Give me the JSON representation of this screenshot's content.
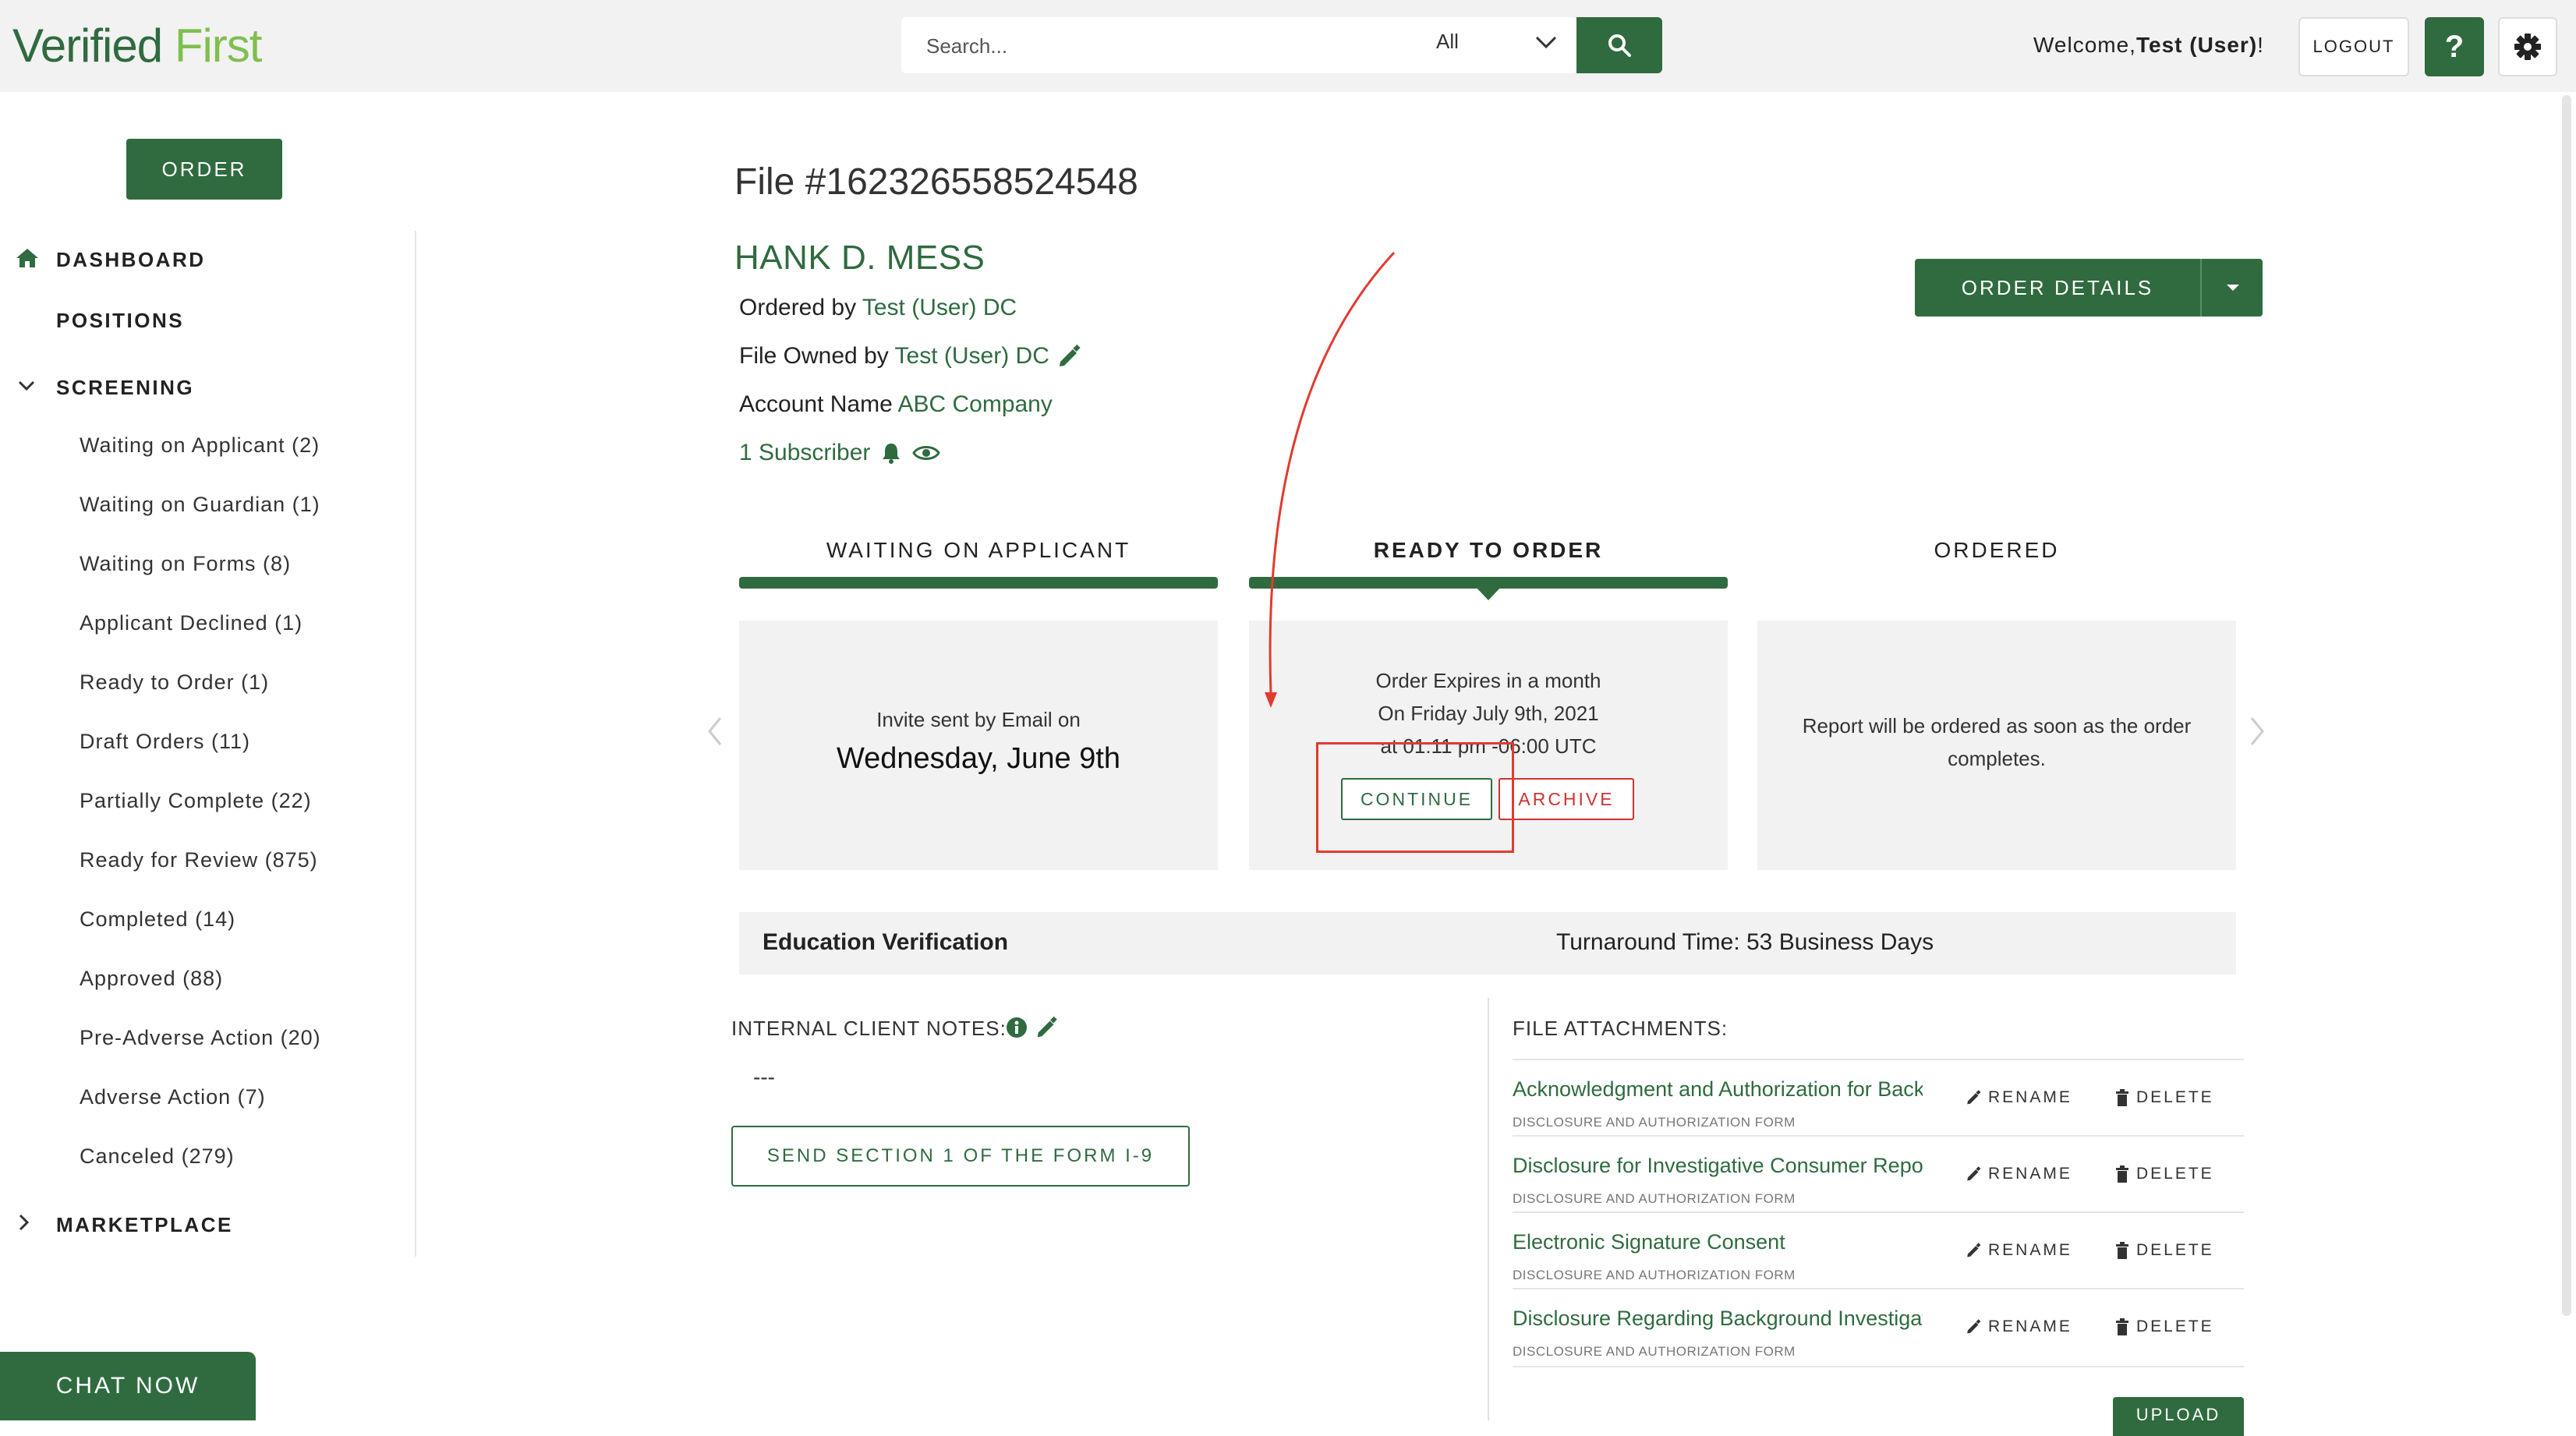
{
  "header": {
    "logo_part1": "Verified",
    "logo_part2": "First",
    "search_placeholder": "Search...",
    "search_scope": "All",
    "welcome_prefix": "Welcome,",
    "welcome_user": "Test (User)",
    "welcome_suffix": "!",
    "logout_label": "LOGOUT",
    "help_label": "?"
  },
  "sidebar": {
    "order_label": "ORDER",
    "dashboard_label": "DASHBOARD",
    "positions_label": "POSITIONS",
    "screening_label": "SCREENING",
    "screening_items": [
      "Waiting on Applicant (2)",
      "Waiting on Guardian (1)",
      "Waiting on Forms (8)",
      "Applicant Declined (1)",
      "Ready to Order (1)",
      "Draft Orders (11)",
      "Partially Complete (22)",
      "Ready for Review (875)",
      "Completed (14)",
      "Approved (88)",
      "Pre-Adverse Action (20)",
      "Adverse Action (7)",
      "Canceled (279)"
    ],
    "marketplace_label": "MARKETPLACE"
  },
  "file": {
    "title": "File #162326558524548",
    "applicant_name": "HANK D. MESS",
    "ordered_by_label": "Ordered by",
    "ordered_by_value": "Test (User) DC",
    "owned_by_label": "File Owned by",
    "owned_by_value": "Test (User) DC",
    "account_label": "Account Name",
    "account_value": "ABC Company",
    "subscriber_text": "1 Subscriber",
    "order_details_label": "ORDER DETAILS"
  },
  "steps": [
    {
      "label": "WAITING ON APPLICANT"
    },
    {
      "label": "READY TO ORDER"
    },
    {
      "label": "ORDERED"
    }
  ],
  "cards": {
    "card1_line1": "Invite sent by Email on",
    "card1_line2": "Wednesday, June 9th",
    "card2_line1": "Order Expires in a month",
    "card2_line2": "On Friday July 9th, 2021",
    "card2_line3": "at 01:11 pm -06:00 UTC",
    "continue_label": "CONTINUE",
    "archive_label": "ARCHIVE",
    "card3_line1": "Report will be ordered as soon as the order",
    "card3_line2": "completes."
  },
  "education": {
    "title": "Education Verification",
    "turnaround": "Turnaround Time: 53 Business Days"
  },
  "notes": {
    "label": "INTERNAL CLIENT NOTES:",
    "value": "---",
    "send_i9_label": "SEND SECTION 1 OF THE FORM I-9"
  },
  "attachments": {
    "label": "FILE ATTACHMENTS:",
    "rename_label": "RENAME",
    "delete_label": "DELETE",
    "upload_label": "UPLOAD",
    "items": [
      {
        "name": "Acknowledgment and Authorization for Background Check",
        "type": "DISCLOSURE AND AUTHORIZATION FORM"
      },
      {
        "name": "Disclosure for Investigative Consumer Report",
        "type": "DISCLOSURE AND AUTHORIZATION FORM"
      },
      {
        "name": "Electronic Signature Consent",
        "type": "DISCLOSURE AND AUTHORIZATION FORM"
      },
      {
        "name": "Disclosure Regarding Background Investigation",
        "type": "DISCLOSURE AND AUTHORIZATION FORM"
      }
    ]
  },
  "chat_label": "CHAT NOW",
  "colors": {
    "brand_green": "#2f6b3f",
    "logo_light_green": "#7fbf4d",
    "archive_red": "#cc3333",
    "annotation_red": "#e13b2e"
  }
}
